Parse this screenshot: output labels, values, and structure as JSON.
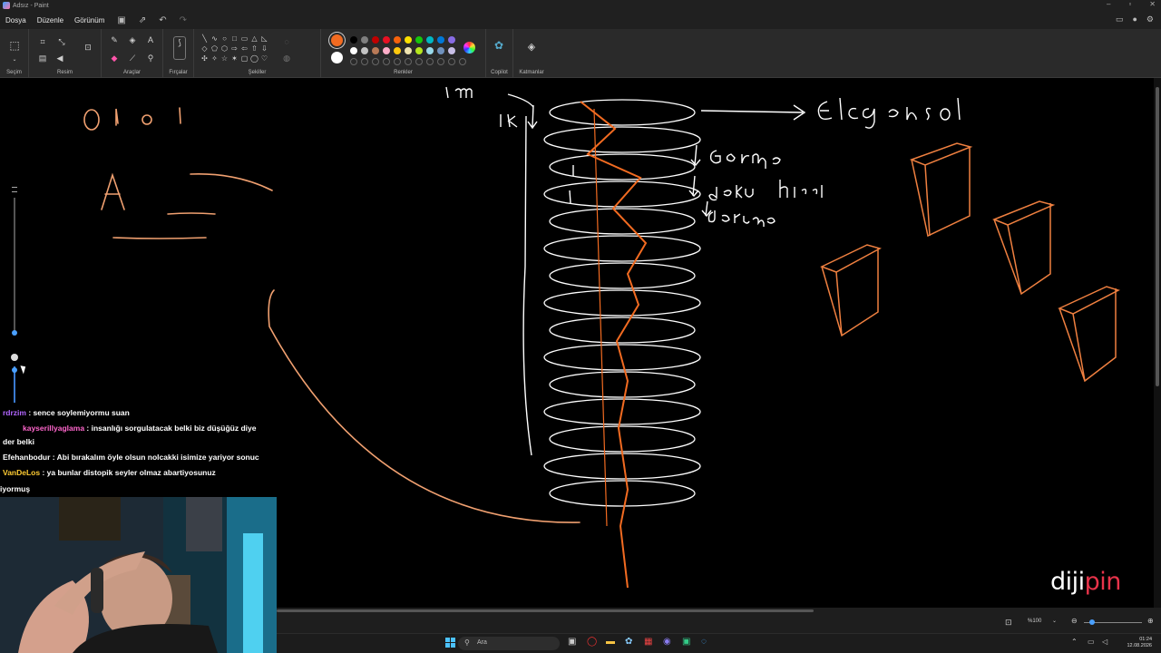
{
  "window": {
    "title": "Adsız - Paint"
  },
  "menu": {
    "file": "Dosya",
    "edit": "Düzenle",
    "view": "Görünüm"
  },
  "ribbon": {
    "selection_label": "Seçim",
    "image_label": "Resim",
    "tools_label": "Araçlar",
    "brushes_label": "Fırçalar",
    "shapes_label": "Şekiller",
    "colors_label": "Renkler",
    "copilot_label": "Copilot",
    "layers_label": "Katmanlar"
  },
  "colors": {
    "primary": "#f26b21",
    "secondary": "#ffffff",
    "accent": "#f26b21",
    "palette_row1": [
      "#000000",
      "#7f7f7f",
      "#c00000",
      "#e81123",
      "#f7630c",
      "#fce100",
      "#16c60c",
      "#00b7c3",
      "#0078d7",
      "#886ce4"
    ],
    "palette_row2": [
      "#ffffff",
      "#c3c3c3",
      "#b97a57",
      "#ffaec9",
      "#ffc90e",
      "#efe4b0",
      "#b5e61d",
      "#99d9ea",
      "#7092be",
      "#c8bfe7"
    ]
  },
  "chat": [
    {
      "user": "rdrzim",
      "message": " : sence soylemiyormu suan",
      "badge": ""
    },
    {
      "user": "kayserillyaglama",
      "message": " : insanlığı sorgulatacak belki biz düşüğüz diye",
      "badge": ""
    },
    {
      "user": "",
      "message": "der belki",
      "badge": ""
    },
    {
      "user": "Efehanbodur",
      "message": " : Abi bırakalım öyle olsun nolcakki isimize yariyor sonuc",
      "badge": ""
    },
    {
      "user": "VanDeLos",
      "message": " : ya bunlar distopik seyler olmaz abartiyosunuz",
      "badge": ""
    },
    {
      "user": "",
      "message": "iyormuş",
      "badge": ""
    }
  ],
  "status": {
    "zoom": "%100"
  },
  "taskbar": {
    "search_placeholder": "Ara",
    "time": "01:24",
    "date": "12.08.2026"
  },
  "brand": {
    "prefix": "diji",
    "suffix": "pin"
  }
}
